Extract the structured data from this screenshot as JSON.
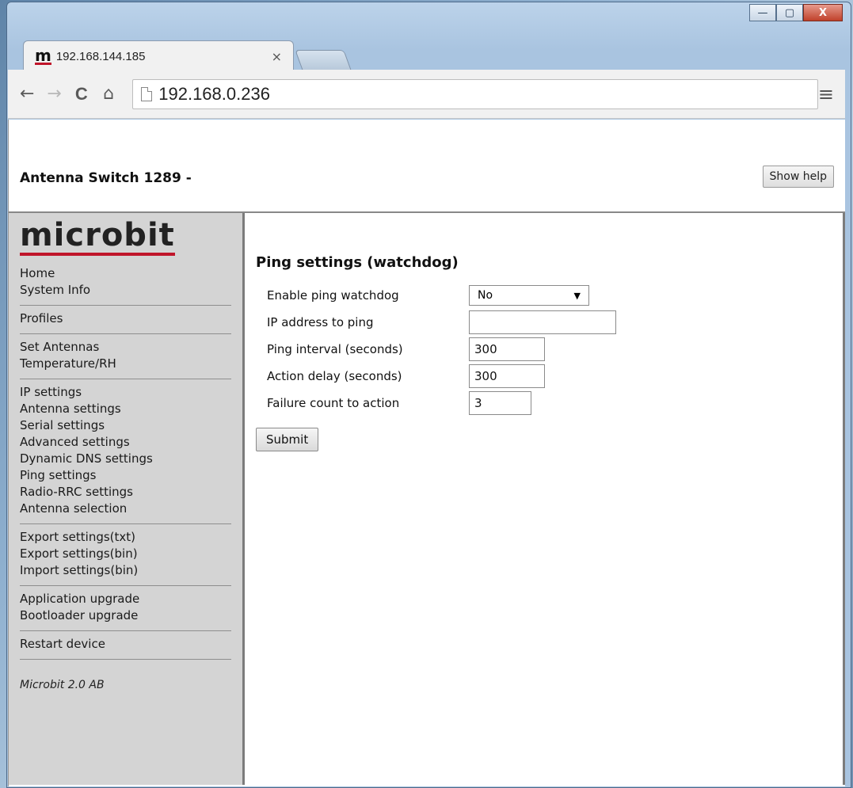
{
  "browser": {
    "tab_title": "192.168.144.185",
    "tab_close": "×",
    "favicon": "m",
    "url": "192.168.0.236",
    "window_controls": {
      "minimize": "—",
      "maximize": "▢",
      "close": "X"
    },
    "nav": {
      "back": "←",
      "forward": "→",
      "reload": "C",
      "home": "⌂",
      "menu": "≡"
    }
  },
  "header": {
    "title": "Antenna Switch 1289 -",
    "help_button": "Show help"
  },
  "sidebar": {
    "logo": "microbit",
    "groups": [
      [
        "Home",
        "System Info"
      ],
      [
        "Profiles"
      ],
      [
        "Set Antennas",
        "Temperature/RH"
      ],
      [
        "IP settings",
        "Antenna settings",
        "Serial settings",
        "Advanced settings",
        "Dynamic DNS settings",
        "Ping settings",
        "Radio-RRC settings",
        "Antenna selection"
      ],
      [
        "Export settings(txt)",
        "Export settings(bin)",
        "Import settings(bin)"
      ],
      [
        "Application upgrade",
        "Bootloader upgrade"
      ],
      [
        "Restart device"
      ]
    ],
    "footer": "Microbit 2.0 AB"
  },
  "form": {
    "title": "Ping settings (watchdog)",
    "enable_label": "Enable ping watchdog",
    "enable_value": "No",
    "enable_arrow": "▼",
    "ip_label": "IP address to ping",
    "ip_value": "",
    "interval_label": "Ping interval (seconds)",
    "interval_value": "300",
    "delay_label": "Action delay (seconds)",
    "delay_value": "300",
    "failure_label": "Failure count to action",
    "failure_value": "3",
    "submit_label": "Submit"
  }
}
